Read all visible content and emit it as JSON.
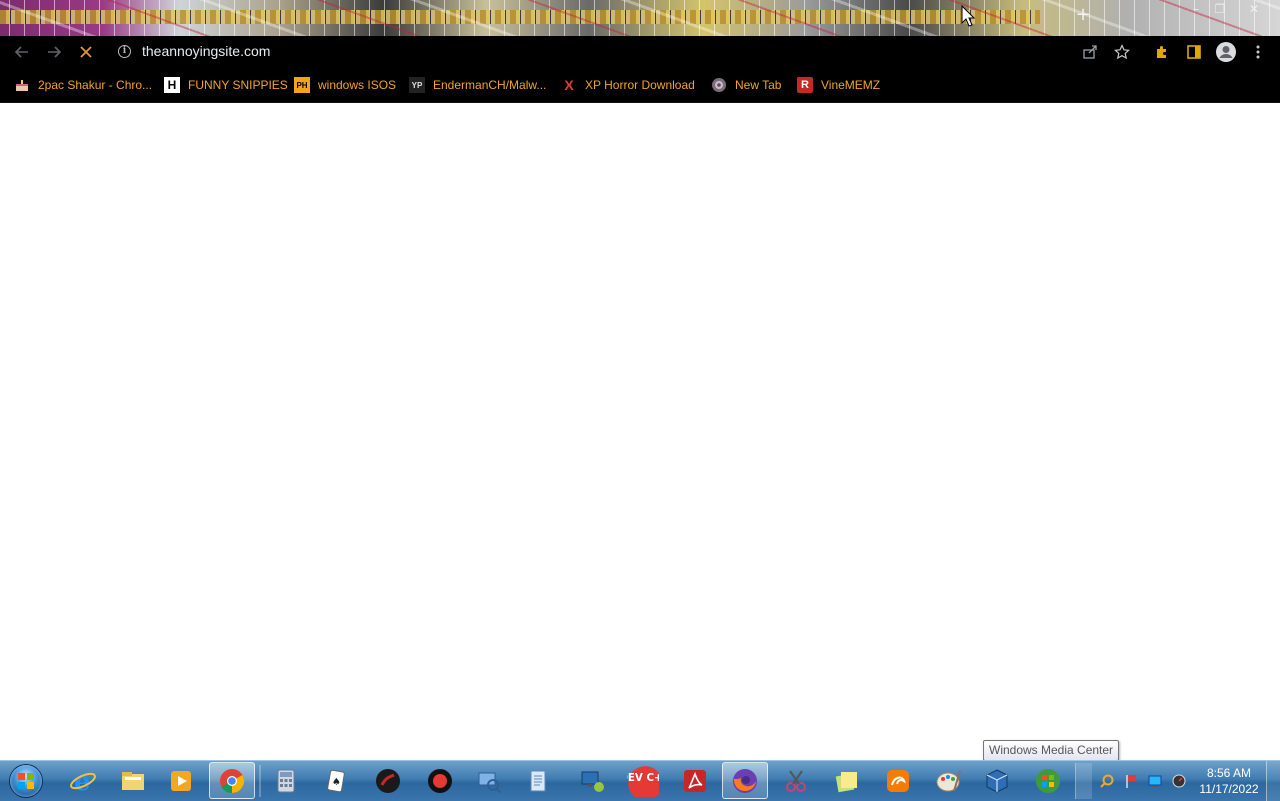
{
  "browser": {
    "new_tab_symbol": "+",
    "window_controls": {
      "minimize": "–",
      "maximize": "❐",
      "close": "✕"
    },
    "url": "theannoyingsite.com",
    "icons": [
      "back-arrow-icon",
      "forward-arrow-icon",
      "stop-loading-icon",
      "site-info-icon",
      "share-icon",
      "bookmark-star-icon",
      "extensions-puzzle-icon",
      "side-panel-icon",
      "profile-icon",
      "kebab-menu-icon"
    ]
  },
  "bookmarks": [
    {
      "label": "2pac Shakur - Chro...",
      "icon": "cake-icon"
    },
    {
      "label": "FUNNY SNIPPIES",
      "icon": "h-logo-icon"
    },
    {
      "label": "windows ISOS",
      "icon": "ph-logo-icon"
    },
    {
      "label": "EndermanCH/Malw...",
      "icon": "yp-logo-icon"
    },
    {
      "label": "XP Horror Download",
      "icon": "x-logo-icon"
    },
    {
      "label": "New Tab",
      "icon": "globe-icon"
    },
    {
      "label": "VineMEMZ",
      "icon": "r-logo-icon"
    }
  ],
  "tooltip": "Windows Media Center",
  "taskbar": {
    "apps": [
      "internet-explorer",
      "file-explorer",
      "media-player",
      "chrome",
      "calculator",
      "solitaire",
      "red-app",
      "recorder",
      "network-app",
      "notepad-app",
      "remote-desktop",
      "dev-cpp",
      "adobe-reader",
      "firefox",
      "snipping-tool",
      "sticky-notes",
      "uc-browser",
      "paint",
      "virtualbox",
      "windows-media-center"
    ],
    "dev_label": "DEV C++",
    "clock_time": "8:56 AM",
    "clock_date": "11/17/2022"
  },
  "colors": {
    "bookmark_text": "#f2a32b",
    "toolbar_bg": "#000000",
    "taskbar_bg": "#3f7cb1"
  }
}
